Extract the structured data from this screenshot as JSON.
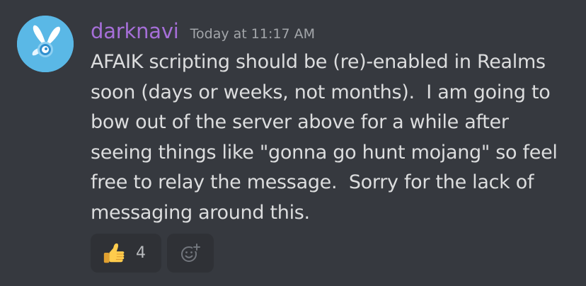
{
  "message": {
    "username": "darknavi",
    "timestamp": "Today at 11:17 AM",
    "lines": [
      "AFAIK scripting should be (re)-enabled in Realms",
      "soon (days or weeks, not months).  I am going to",
      "bow out of the server above for a while after",
      "seeing things like \"gonna go hunt mojang\" so feel",
      "free to relay the message.  Sorry for the lack of",
      "messaging around this."
    ],
    "reactions": [
      {
        "emoji": "thumbs-up-icon",
        "count": "4"
      }
    ],
    "add_reaction_icon": "add-reaction-icon"
  },
  "colors": {
    "background": "#36393f",
    "username": "#a66fd8",
    "timestamp": "#a3a6aa",
    "text": "#dcddde",
    "reaction_bg": "#2f3136"
  }
}
